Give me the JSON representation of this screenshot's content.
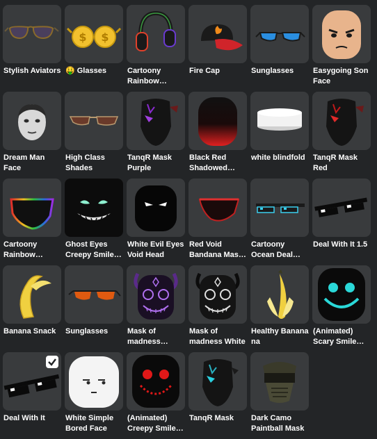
{
  "items": [
    {
      "label": "Stylish Aviators",
      "icon": "aviator-sunglasses-icon",
      "selected": false
    },
    {
      "label": "🤑 Glasses",
      "icon": "money-glasses-icon",
      "selected": false
    },
    {
      "label": "Cartoony Rainbow…",
      "icon": "rainbow-headphones-icon",
      "selected": false
    },
    {
      "label": "Fire Cap",
      "icon": "fire-cap-icon",
      "selected": false
    },
    {
      "label": "Sunglasses",
      "icon": "blue-sunglasses-icon",
      "selected": false
    },
    {
      "label": "Easygoing Son Face",
      "icon": "cartoon-face-icon",
      "selected": false
    },
    {
      "label": "Dream Man Face",
      "icon": "photo-face-icon",
      "selected": false
    },
    {
      "label": "High Class Shades",
      "icon": "brown-shades-icon",
      "selected": false
    },
    {
      "label": "TanqR Mask Purple",
      "icon": "purple-mask-icon",
      "selected": false
    },
    {
      "label": "Black Red Shadowed Hea…",
      "icon": "black-red-head-icon",
      "selected": false
    },
    {
      "label": "white blindfold",
      "icon": "white-blindfold-icon",
      "selected": false
    },
    {
      "label": "TanqR Mask Red",
      "icon": "red-mask-icon",
      "selected": false
    },
    {
      "label": "Cartoony Rainbow Ninja…",
      "icon": "rainbow-ninja-mask-icon",
      "selected": false
    },
    {
      "label": "Ghost Eyes Creepy Smile…",
      "icon": "ghost-eyes-smile-icon",
      "selected": false
    },
    {
      "label": "White Evil Eyes Void Head",
      "icon": "evil-eyes-head-icon",
      "selected": false
    },
    {
      "label": "Red Void Bandana Mask …",
      "icon": "red-bandana-icon",
      "selected": false
    },
    {
      "label": "Cartoony Ocean Deal With It…",
      "icon": "pixel-glasses-blue-icon",
      "selected": false
    },
    {
      "label": "Deal With It 1.5",
      "icon": "pixel-glasses-icon",
      "selected": false
    },
    {
      "label": "Banana Snack",
      "icon": "banana-icon",
      "selected": false
    },
    {
      "label": "Sunglasses",
      "icon": "orange-sunglasses-icon",
      "selected": false
    },
    {
      "label": "Mask of madness Purple",
      "icon": "madness-mask-purple-icon",
      "selected": false
    },
    {
      "label": "Mask of madness White",
      "icon": "madness-mask-white-icon",
      "selected": false
    },
    {
      "label": "Healthy Banana na",
      "icon": "banana-hat-icon",
      "selected": false
    },
    {
      "label": "(Animated) Scary Smile…",
      "icon": "scary-smile-cyan-icon",
      "selected": false
    },
    {
      "label": "Deal With It",
      "icon": "pixel-glasses-large-icon",
      "selected": true
    },
    {
      "label": "White Simple Bored Face",
      "icon": "bored-face-icon",
      "selected": false
    },
    {
      "label": "(Animated) Creepy Smile…",
      "icon": "creepy-smile-red-icon",
      "selected": false
    },
    {
      "label": "TanqR Mask",
      "icon": "cyan-mask-icon",
      "selected": false
    },
    {
      "label": "Dark Camo Paintball Mask",
      "icon": "paintball-mask-icon",
      "selected": false
    }
  ]
}
